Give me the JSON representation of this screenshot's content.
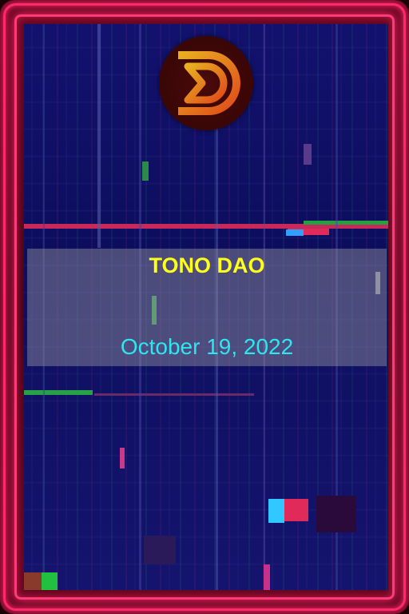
{
  "card": {
    "title": "TONO DAO",
    "date": "October 19, 2022",
    "logo_icon": "tono-dao-logo",
    "colors": {
      "frame": "#ff2a6a",
      "title": "#ffff1a",
      "date": "#2ee6f0",
      "background": "#12126e",
      "logo_gold": "#e0a020",
      "logo_red": "#e03a1a"
    }
  }
}
